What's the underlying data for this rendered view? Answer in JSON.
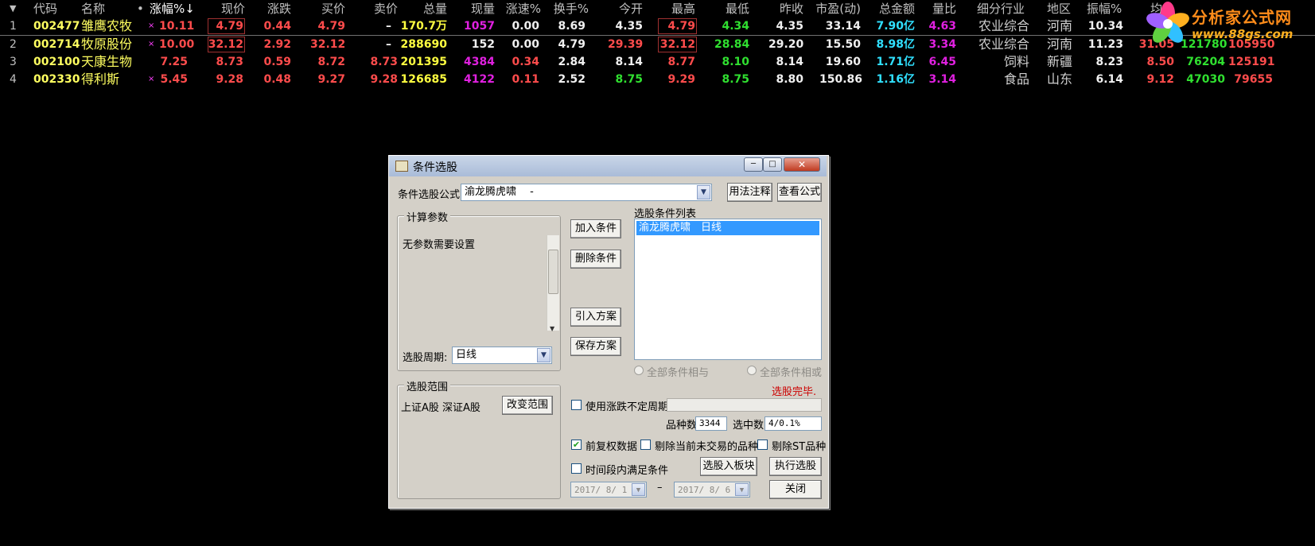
{
  "header": {
    "menu_arrow": "▼",
    "columns": [
      "代码",
      "名称",
      "•",
      "涨幅%↓",
      "现价",
      "涨跌",
      "买价",
      "卖价",
      "总量",
      "现量",
      "涨速%",
      "换手%",
      "今开",
      "最高",
      "最低",
      "昨收",
      "市盈(动)",
      "总金额",
      "量比",
      "细分行业",
      "地区",
      "振幅%",
      "均"
    ]
  },
  "rows": [
    {
      "idx": "1",
      "code": "002477",
      "name": "雏鹰农牧",
      "mark": "×",
      "pct": "10.11",
      "price": "4.79",
      "chg": "0.44",
      "bid": "4.79",
      "ask": "–",
      "vol": "170.7万",
      "curvol": "1057",
      "speed": "0.00",
      "turn": "8.69",
      "open": "4.35",
      "high": "4.79",
      "low": "4.34",
      "prev": "4.35",
      "pe": "33.14",
      "amount": "7.90亿",
      "vr": "4.63",
      "industry": "农业综合",
      "region": "河南",
      "amp": "10.34",
      "avg": "",
      "a": "",
      "b": ""
    },
    {
      "idx": "2",
      "code": "002714",
      "name": "牧原股份",
      "mark": "×",
      "pct": "10.00",
      "price": "32.12",
      "chg": "2.92",
      "bid": "32.12",
      "ask": "–",
      "vol": "288690",
      "curvol": "152",
      "speed": "0.00",
      "turn": "4.79",
      "open": "29.39",
      "high": "32.12",
      "low": "28.84",
      "prev": "29.20",
      "pe": "15.50",
      "amount": "8.98亿",
      "vr": "3.34",
      "industry": "农业综合",
      "region": "河南",
      "amp": "11.23",
      "avg": "31.05",
      "a": "121780",
      "b": "105950"
    },
    {
      "idx": "3",
      "code": "002100",
      "name": "天康生物",
      "mark": "",
      "pct": "7.25",
      "price": "8.73",
      "chg": "0.59",
      "bid": "8.72",
      "ask": "8.73",
      "vol": "201395",
      "curvol": "4384",
      "speed": "0.34",
      "turn": "2.84",
      "open": "8.14",
      "high": "8.77",
      "low": "8.10",
      "prev": "8.14",
      "pe": "19.60",
      "amount": "1.71亿",
      "vr": "6.45",
      "industry": "饲料",
      "region": "新疆",
      "amp": "8.23",
      "avg": "8.50",
      "a": "76204",
      "b": "125191"
    },
    {
      "idx": "4",
      "code": "002330",
      "name": "得利斯",
      "mark": "×",
      "pct": "5.45",
      "price": "9.28",
      "chg": "0.48",
      "bid": "9.27",
      "ask": "9.28",
      "vol": "126685",
      "curvol": "4122",
      "speed": "0.11",
      "turn": "2.52",
      "open": "8.75",
      "high": "9.29",
      "low": "8.75",
      "prev": "8.80",
      "pe": "150.86",
      "amount": "1.16亿",
      "vr": "3.14",
      "industry": "食品",
      "region": "山东",
      "amp": "6.14",
      "avg": "9.12",
      "a": "47030",
      "b": "79655"
    }
  ],
  "logo": {
    "title": "分析家公式网",
    "url": "www.88gs.com"
  },
  "dialog": {
    "title": "条件选股",
    "buttons": {
      "min": "─",
      "max": "□",
      "close": "✕"
    },
    "formula_label": "条件选股公式",
    "formula_value": "渝龙腾虎啸　 -",
    "usage_btn": "用法注释",
    "view_btn": "查看公式",
    "params_group": "计算参数",
    "params_text": "无参数需要设置",
    "period_label": "选股周期:",
    "period_value": "日线",
    "add_btn": "加入条件",
    "del_btn": "删除条件",
    "import_btn": "引入方案",
    "save_btn": "保存方案",
    "list_title": "选股条件列表",
    "list_item": "渝龙腾虎啸　日线",
    "radio_and": "全部条件相与",
    "radio_or": "全部条件相或",
    "status": "选股完毕.",
    "scope_group": "选股范围",
    "scope_text": "上证A股 深证A股",
    "change_scope_btn": "改变范围",
    "use_flex_period": "使用涨跌不定周期",
    "count_label": "品种数",
    "count_value": "3344",
    "selected_label": "选中数",
    "selected_value": "4/0.1%",
    "pre_adjust": "前复权数据",
    "exclude_no_trade": "剔除当前未交易的品种",
    "exclude_st": "剔除ST品种",
    "time_range": "时间段内满足条件",
    "to_block_btn": "选股入板块",
    "execute_btn": "执行选股",
    "date_from": "2017/ 8/ 1",
    "date_sep": "–",
    "date_to": "2017/ 8/ 6",
    "close_btn": "关闭",
    "colors": {
      "title_gradient_top": "#c9d6e8",
      "selection": "#3399ff",
      "status": "#cc0000"
    }
  }
}
